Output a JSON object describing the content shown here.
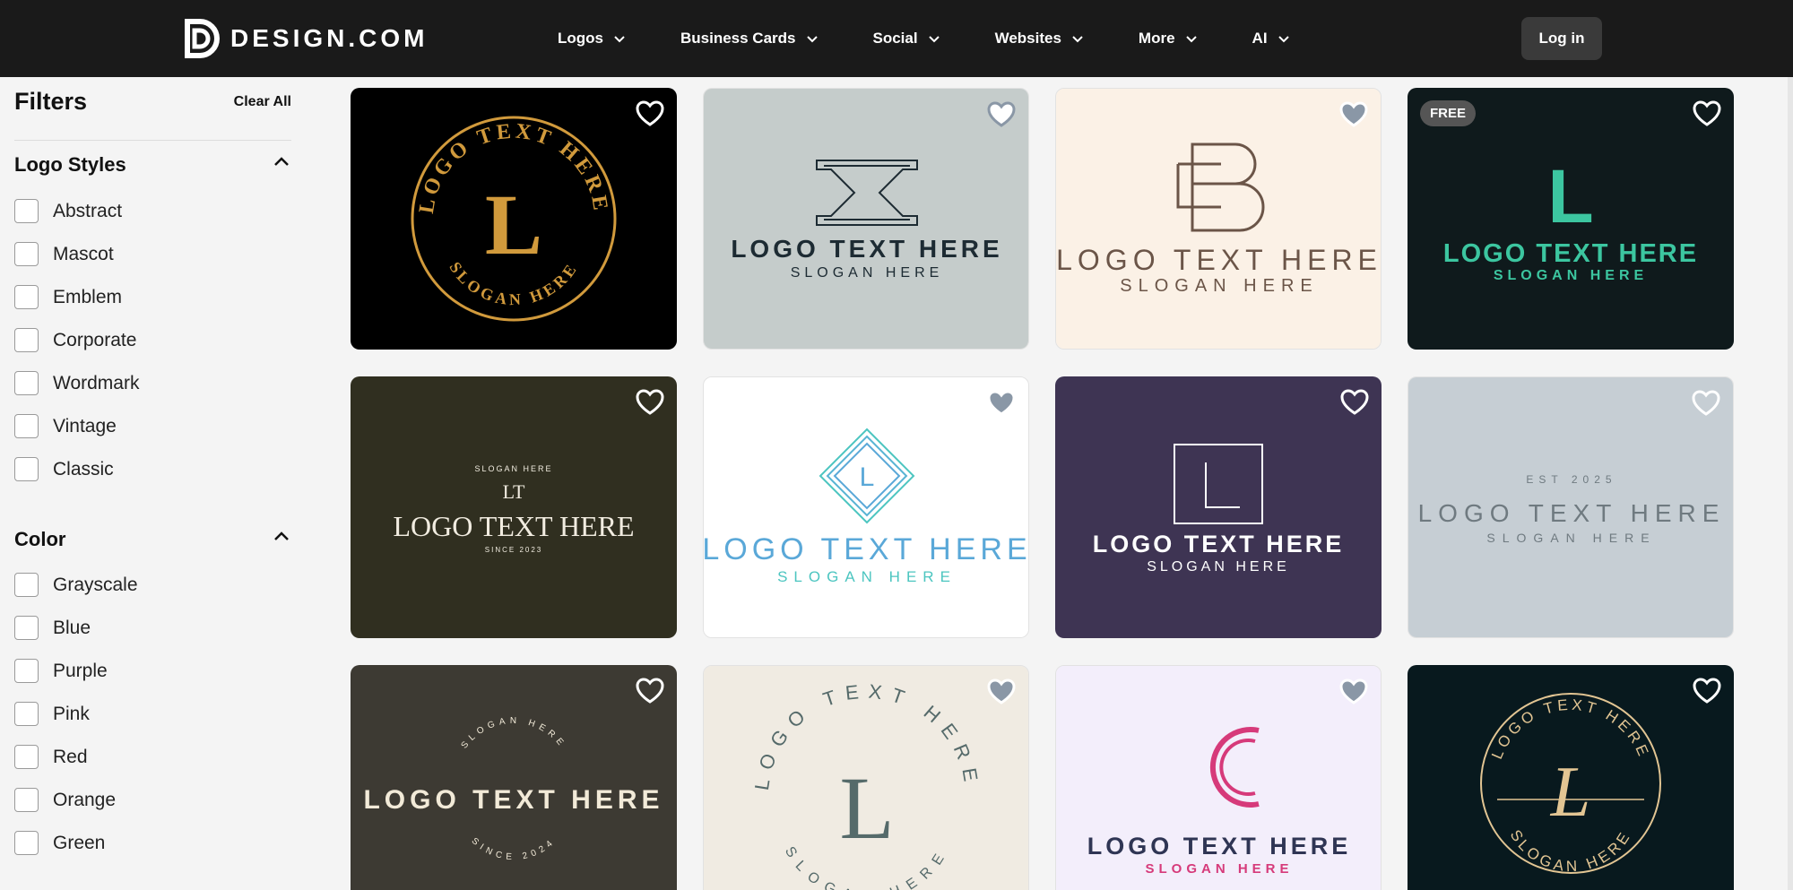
{
  "header": {
    "brand": "DESIGN.COM",
    "nav": [
      {
        "label": "Logos"
      },
      {
        "label": "Business Cards"
      },
      {
        "label": "Social"
      },
      {
        "label": "Websites"
      },
      {
        "label": "More"
      },
      {
        "label": "AI"
      }
    ],
    "login": "Log in"
  },
  "sidebar": {
    "title": "Filters",
    "clear": "Clear All",
    "styles_title": "Logo Styles",
    "styles": [
      "Abstract",
      "Mascot",
      "Emblem",
      "Corporate",
      "Wordmark",
      "Vintage",
      "Classic"
    ],
    "color_title": "Color",
    "colors": [
      "Grayscale",
      "Blue",
      "Purple",
      "Pink",
      "Red",
      "Orange",
      "Green"
    ]
  },
  "cards": [
    {
      "bg": "#000000",
      "fg": "#d19a3c",
      "text": "LOGO TEXT HERE",
      "slogan": "SLOGAN HERE",
      "mono": "L"
    },
    {
      "bg": "#c5cccb",
      "fg": "#1d2b33",
      "text": "LOGO TEXT HERE",
      "slogan": "SLOGAN HERE",
      "mono": "X"
    },
    {
      "bg": "#fbf1e6",
      "fg": "#6b5548",
      "text": "LOGO TEXT HERE",
      "slogan": "SLOGAN HERE",
      "mono": "B"
    },
    {
      "bg": "#0f1a1c",
      "fg": "#3cc6a0",
      "text": "LOGO TEXT HERE",
      "slogan": "SLOGAN HERE",
      "mono": "L",
      "badge": "FREE"
    },
    {
      "bg": "#302f20",
      "fg": "#f1ece0",
      "text": "LOGO TEXT HERE",
      "slogan": "SINCE 2023",
      "mono": "LT",
      "top": "SLOGAN HERE"
    },
    {
      "bg": "#ffffff",
      "fg": "#5aa8d8",
      "text": "LOGO TEXT HERE",
      "slogan": "SLOGAN HERE",
      "mono": "L"
    },
    {
      "bg": "#3e3453",
      "fg": "#ffffff",
      "text": "LOGO TEXT HERE",
      "slogan": "SLOGAN HERE",
      "mono": "L"
    },
    {
      "bg": "#c6ced4",
      "fg": "#6f7a80",
      "text": "LOGO TEXT HERE",
      "slogan": "SLOGAN HERE",
      "top": "EST 2025"
    },
    {
      "bg": "#3d3a33",
      "fg": "#f2ead8",
      "text": "LOGO TEXT HERE",
      "slogan": "SINCE 2024",
      "top": "SLOGAN HERE"
    },
    {
      "bg": "#f0ebe2",
      "fg": "#556a6a",
      "text": "LOGO TEXT HERE",
      "slogan": "SLOGAN HERE",
      "mono": "L"
    },
    {
      "bg": "#f3eefb",
      "fg": "#2f3554",
      "text": "LOGO TEXT HERE",
      "slogan": "SLOGAN HERE",
      "mono": "C",
      "accent": "#d63a7a"
    },
    {
      "bg": "#08191e",
      "fg": "#e2c593",
      "text": "LOGO TEXT HERE",
      "slogan": "SLOGAN HERE",
      "mono": "L"
    }
  ]
}
